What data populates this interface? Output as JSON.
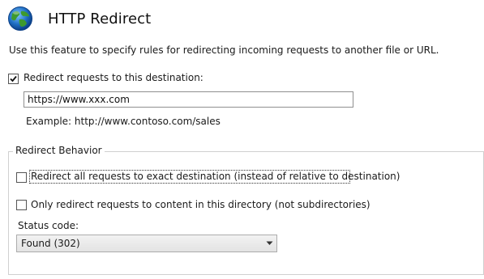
{
  "header": {
    "title": "HTTP Redirect",
    "icon": "globe-icon"
  },
  "description": "Use this feature to specify rules for redirecting incoming requests to another file or URL.",
  "redirect_destination": {
    "label": "Redirect requests to this destination:",
    "checked": true,
    "value": "https://www.xxx.com",
    "example": "Example: http://www.contoso.com/sales"
  },
  "redirect_behavior": {
    "legend": "Redirect Behavior",
    "exact_destination": {
      "label": "Redirect all requests to exact destination (instead of relative to destination)",
      "checked": false
    },
    "only_this_directory": {
      "label": "Only redirect requests to content in this directory (not subdirectories)",
      "checked": false
    },
    "status_code": {
      "label": "Status code:",
      "selected": "Found (302)"
    }
  },
  "colors": {
    "checkbox_border": "#555555",
    "groupbox_border": "#d0d0d0",
    "globe_blue": "#1f6fc4",
    "globe_green": "#3d9a2e"
  }
}
